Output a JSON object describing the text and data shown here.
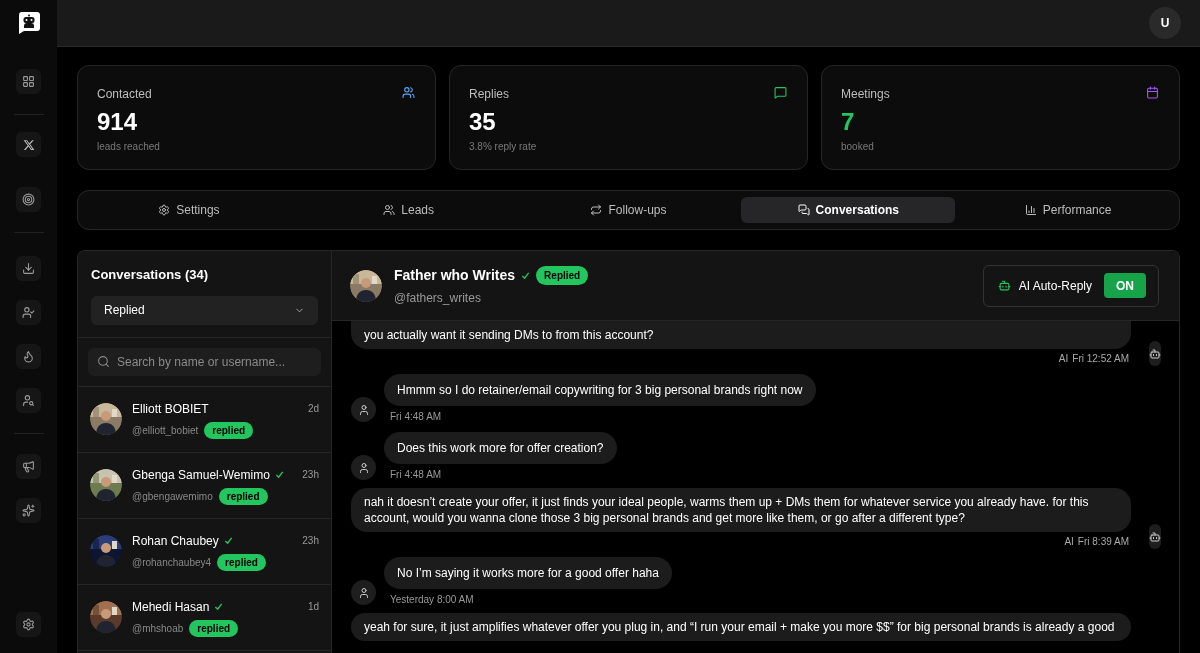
{
  "header": {
    "avatar_initial": "U"
  },
  "stats": [
    {
      "kind": "users",
      "label": "Contacted",
      "value": "914",
      "caption": "leads reached"
    },
    {
      "kind": "replies",
      "label": "Replies",
      "value": "35",
      "caption": "3.8% reply rate"
    },
    {
      "kind": "meetings",
      "label": "Meetings",
      "value": "7",
      "caption": "booked"
    }
  ],
  "tabs": [
    {
      "kind": "settings",
      "label": "Settings",
      "selected": false
    },
    {
      "kind": "leads",
      "label": "Leads",
      "selected": false
    },
    {
      "kind": "followups",
      "label": "Follow-ups",
      "selected": false
    },
    {
      "kind": "conversations",
      "label": "Conversations",
      "selected": true
    },
    {
      "kind": "performance",
      "label": "Performance",
      "selected": false
    }
  ],
  "conversations": {
    "title": "Conversations (34)",
    "filter": "Replied",
    "search_placeholder": "Search by name or username...",
    "items": [
      {
        "name": "Elliott BOBIET",
        "verified": false,
        "username": "@elliott_bobiet",
        "badge": "replied",
        "time": "2d"
      },
      {
        "name": "Gbenga Samuel-Wemimo",
        "verified": true,
        "username": "@gbengawemimo",
        "badge": "replied",
        "time": "23h"
      },
      {
        "name": "Rohan Chaubey",
        "verified": true,
        "username": "@rohanchaubey4",
        "badge": "replied",
        "time": "23h"
      },
      {
        "name": "Mehedi Hasan",
        "verified": true,
        "username": "@mhshoab",
        "badge": "replied",
        "time": "1d"
      }
    ]
  },
  "chat": {
    "name": "Father who Writes",
    "verified": true,
    "badge": "Replied",
    "username": "@fathers_writes",
    "auto_reply": {
      "label": "AI Auto-Reply",
      "on": true,
      "state_label": "ON"
    },
    "messages": [
      {
        "kind": "ai",
        "text": "you actually want it sending DMs to from this account?",
        "ai_label": "AI",
        "time": "Fri 12:52 AM"
      },
      {
        "kind": "lead",
        "text": "Hmmm so I do retainer/email copywriting for 3 big personal brands right now",
        "time": "Fri 4:48 AM"
      },
      {
        "kind": "lead",
        "text": "Does this work more for offer creation?",
        "time": "Fri 4:48 AM"
      },
      {
        "kind": "ai",
        "text": "nah it doesn’t create your offer, it just finds your ideal people, warms them up + DMs them for whatever service you already have. for this account, would you wanna clone those 3 big personal brands and get more like them, or go after a different type?",
        "ai_label": "AI",
        "time": "Fri 8:39 AM"
      },
      {
        "kind": "lead",
        "text": "No I’m saying it works more for a good offer haha",
        "time": "Yesterday 8:00 AM"
      },
      {
        "kind": "ai",
        "text": "yeah for sure, it just amplifies whatever offer you plug in, and “I run your email + make you more $$” for big personal brands is already a good"
      }
    ]
  }
}
